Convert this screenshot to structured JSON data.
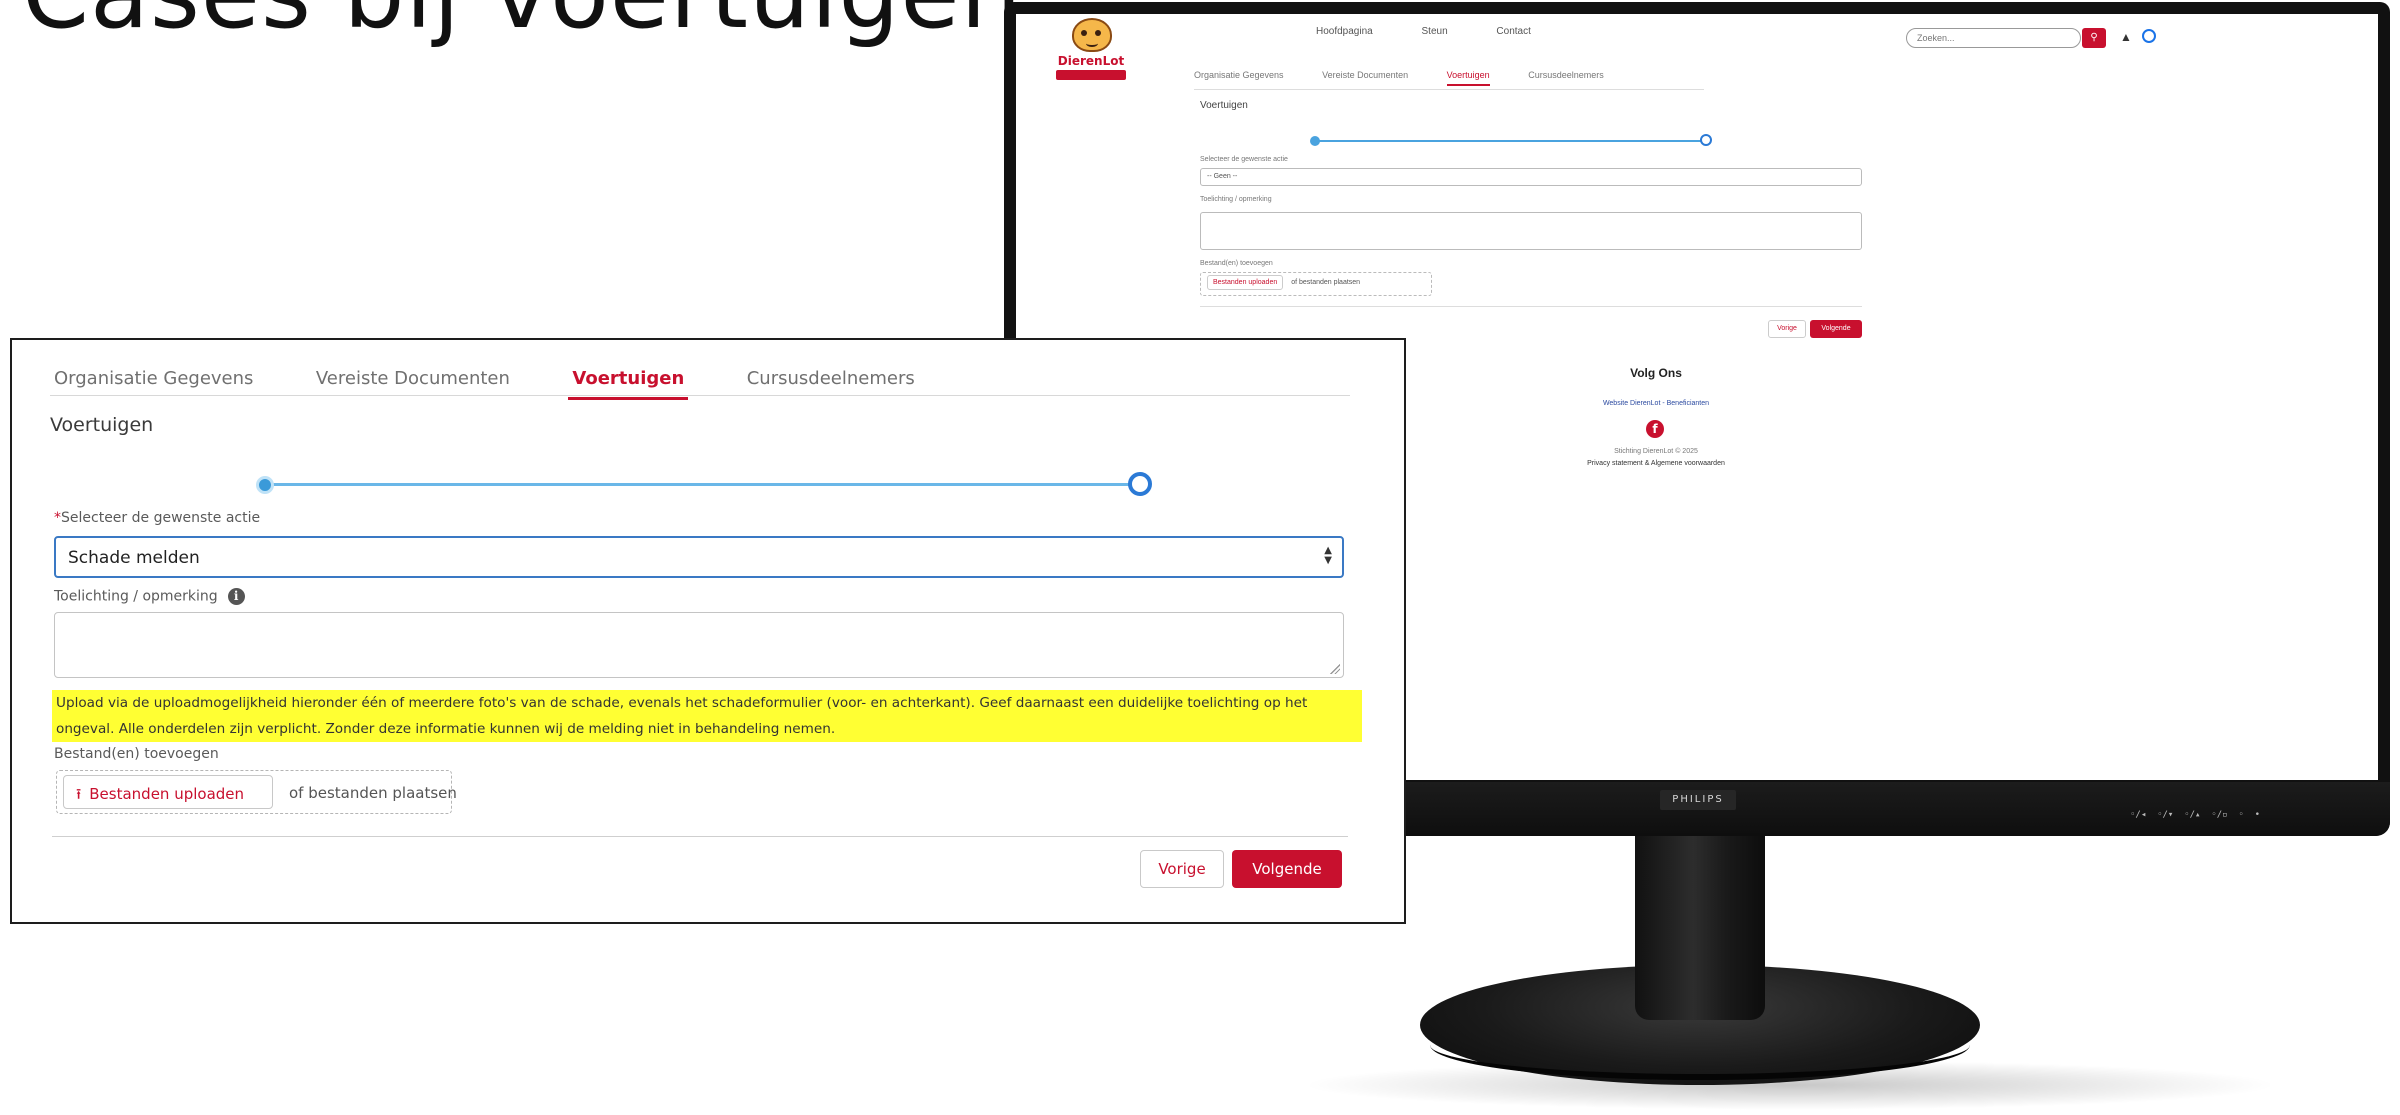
{
  "slide": {
    "title": "Cases bij voertuigen"
  },
  "monitor": {
    "brand": "PHILIPS"
  },
  "screen_site": {
    "logo_text": "DierenLot",
    "nav": [
      "Hoofdpagina",
      "Steun",
      "Contact"
    ],
    "search_placeholder": "Zoeken...",
    "tabs": [
      "Organisatie Gegevens",
      "Vereiste Documenten",
      "Voertuigen",
      "Cursusdeelnemers"
    ],
    "active_tab_index": 2,
    "section_title": "Voertuigen",
    "select_label": "Selecteer de gewenste actie",
    "select_value": "-- Geen --",
    "remark_label": "Toelichting / opmerking",
    "files_label": "Bestand(en) toevoegen",
    "upload_button": "Bestanden uploaden",
    "drop_text": "of bestanden plaatsen",
    "prev_button": "Vorige",
    "next_button": "Volgende",
    "footer_title": "Volg Ons",
    "footer_links": "Website DierenLot - Beneficianten",
    "copyright": "Stichting DierenLot © 2025",
    "privacy": "Privacy statement & Algemene voorwaarden"
  },
  "panel": {
    "tabs": [
      {
        "label": "Organisatie Gegevens"
      },
      {
        "label": "Vereiste Documenten"
      },
      {
        "label": "Voertuigen"
      },
      {
        "label": "Cursusdeelnemers"
      }
    ],
    "active_tab": "Voertuigen",
    "section_title": "Voertuigen",
    "progress": {
      "steps": 2,
      "current_step": 1
    },
    "select": {
      "required_mark": "*",
      "label": "Selecteer de gewenste actie",
      "value": "Schade melden"
    },
    "remark": {
      "label": "Toelichting / opmerking",
      "info_glyph": "i",
      "value": ""
    },
    "instruction": "Upload via de uploadmogelijkheid hieronder één of meerdere foto's van de schade, evenals het schadeformulier (voor- en achterkant). Geef daarnaast een duidelijke toelichting op het ongeval. Alle onderdelen zijn verplicht. Zonder deze informatie kunnen wij de melding niet in behandeling nemen.",
    "files": {
      "label": "Bestand(en) toevoegen",
      "upload_button": "Bestanden uploaden",
      "drop_text": "of bestanden plaatsen"
    },
    "buttons": {
      "prev": "Vorige",
      "next": "Volgende"
    }
  },
  "colors": {
    "brand_red": "#c8102e",
    "progress_blue": "#3a9ad9",
    "highlight_yellow": "#ffff33",
    "focus_border": "#3a79c4"
  },
  "icons": [
    "upload-icon",
    "info-icon",
    "bell-icon",
    "user-icon",
    "search-icon",
    "facebook-icon",
    "select-arrows-icon"
  ]
}
